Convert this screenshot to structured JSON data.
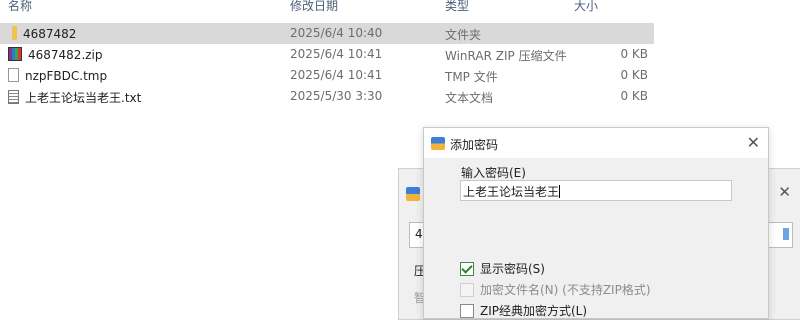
{
  "columns": {
    "name": "名称",
    "date": "修改日期",
    "type": "类型",
    "size": "大小"
  },
  "files": [
    {
      "name": "4687482",
      "date": "2025/6/4 10:40",
      "type": "文件夹",
      "size": "",
      "icon": "folder-icon",
      "selected": true
    },
    {
      "name": "4687482.zip",
      "date": "2025/6/4 10:41",
      "type": "WinRAR ZIP 压缩文件",
      "size": "0 KB",
      "icon": "winrar-archive-icon"
    },
    {
      "name": "nzpFBDC.tmp",
      "date": "2025/6/4 10:41",
      "type": "TMP 文件",
      "size": "0 KB",
      "icon": "blank-file-icon"
    },
    {
      "name": "上老王论坛当老王.txt",
      "date": "2025/5/30 3:30",
      "type": "文本文档",
      "size": "0 KB",
      "icon": "text-file-icon"
    }
  ],
  "back_dialog": {
    "input_value": "4",
    "label_1": "压",
    "label_2": "智"
  },
  "password_dialog": {
    "title": "添加密码",
    "close_glyph": "✕",
    "password_label": "输入密码(E)",
    "password_value": "上老王论坛当老王",
    "show_password_label": "显示密码(S)",
    "show_password_checked": true,
    "encrypt_names_label": "加密文件名(N) (不支持ZIP格式)",
    "encrypt_names_enabled": false,
    "zip_legacy_label": "ZIP经典加密方式(L)"
  }
}
